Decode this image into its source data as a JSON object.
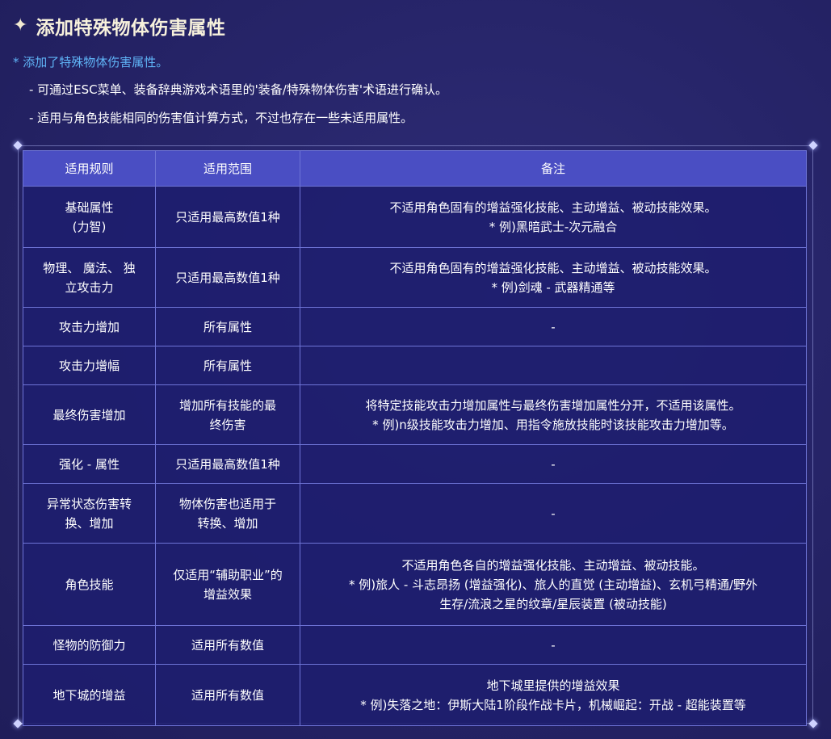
{
  "header": {
    "title": "添加特殊物体伤害属性",
    "icon": "sparkle-star-icon"
  },
  "notes": {
    "main": "* 添加了特殊物体伤害属性。",
    "items": [
      "- 可通过ESC菜单、装备辞典游戏术语里的'装备/特殊物体伤害'术语进行确认。",
      "- 适用与角色技能相同的伤害值计算方式，不过也存在一些未适用属性。"
    ]
  },
  "table": {
    "headers": [
      "适用规则",
      "适用范围",
      "备注"
    ],
    "rows": [
      {
        "rule": [
          "基础属性",
          "(力智)"
        ],
        "scope": [
          "只适用最高数值1种"
        ],
        "remark": [
          "不适用角色固有的增益强化技能、主动增益、被动技能效果。",
          "* 例)黑暗武士-次元融合"
        ]
      },
      {
        "rule": [
          "物理、 魔法、 独",
          "立攻击力"
        ],
        "scope": [
          "只适用最高数值1种"
        ],
        "remark": [
          "不适用角色固有的增益强化技能、主动增益、被动技能效果。",
          "* 例)剑魂 - 武器精通等"
        ]
      },
      {
        "rule": [
          "攻击力增加"
        ],
        "scope": [
          "所有属性"
        ],
        "remark": [
          "-"
        ]
      },
      {
        "rule": [
          "攻击力增幅"
        ],
        "scope": [
          "所有属性"
        ],
        "remark": []
      },
      {
        "rule": [
          "最终伤害增加"
        ],
        "scope": [
          "增加所有技能的最",
          "终伤害"
        ],
        "remark": [
          "将特定技能攻击力增加属性与最终伤害增加属性分开，不适用该属性。",
          "* 例)n级技能攻击力增加、用指令施放技能时该技能攻击力增加等。"
        ]
      },
      {
        "rule": [
          "强化 - 属性"
        ],
        "scope": [
          "只适用最高数值1种"
        ],
        "remark": [
          "-"
        ]
      },
      {
        "rule": [
          "异常状态伤害转",
          "换、增加"
        ],
        "scope": [
          "物体伤害也适用于",
          "转换、增加"
        ],
        "remark": [
          "-"
        ]
      },
      {
        "rule": [
          "角色技能"
        ],
        "scope": [
          "仅适用“辅助职业”的",
          "增益效果"
        ],
        "remark": [
          "不适用角色各自的增益强化技能、主动增益、被动技能。",
          "* 例)旅人 - 斗志昂扬 (增益强化)、旅人的直觉 (主动增益)、玄机弓精通/野外",
          "生存/流浪之星的纹章/星辰装置 (被动技能)"
        ]
      },
      {
        "rule": [
          "怪物的防御力"
        ],
        "scope": [
          "适用所有数值"
        ],
        "remark": [
          "-"
        ]
      },
      {
        "rule": [
          "地下城的增益"
        ],
        "scope": [
          "适用所有数值"
        ],
        "remark": [
          "地下城里提供的增益效果",
          "* 例)失落之地：伊斯大陆1阶段作战卡片，机械崛起：开战 - 超能装置等"
        ]
      }
    ]
  }
}
